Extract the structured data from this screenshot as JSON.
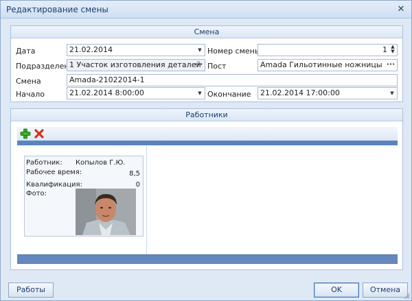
{
  "window": {
    "title": "Редактирование смены",
    "close_icon": "close-icon"
  },
  "shift_group": {
    "header": "Смена",
    "date": {
      "label": "Дата",
      "value": "21.02.2014"
    },
    "shift_number": {
      "label": "Номер смены",
      "value": "1"
    },
    "department": {
      "label": "Подразделение",
      "value": "1 Участок изготовления деталей"
    },
    "post": {
      "label": "Пост",
      "value": "Amada Гильотинные ножницы"
    },
    "shift": {
      "label": "Смена",
      "value": "Amada-21022014-1"
    },
    "start": {
      "label": "Начало",
      "value": "21.02.2014 8:00:00"
    },
    "end": {
      "label": "Окончание",
      "value": "21.02.2014 17:00:00"
    }
  },
  "workers_group": {
    "header": "Работники",
    "toolbar": {
      "add_icon": "add-icon",
      "delete_icon": "delete-icon"
    },
    "card": {
      "worker_label": "Работник:",
      "worker_value": "Копылов Г.Ю.",
      "work_time_label": "Рабочее время:",
      "work_time_value": "8,5",
      "qualification_label": "Квалификация:",
      "qualification_value": "0",
      "photo_label": "Фото:"
    }
  },
  "footer": {
    "jobs_button": "Работы",
    "ok_button": "OK",
    "cancel_button": "Отмена"
  },
  "colors": {
    "accent": "#5b84bd",
    "header_text": "#1d3e6e"
  }
}
